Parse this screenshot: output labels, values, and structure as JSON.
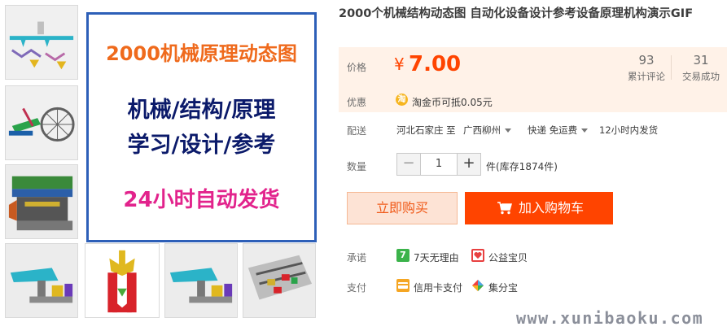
{
  "gallery": {
    "main_title": "2000机械原理动态图",
    "main_line1": "机械/结构/原理",
    "main_line2": "学习/设计/参考",
    "main_shipping": "24小时自动发货"
  },
  "product": {
    "title": "2000个机械结构动态图 自动化设备设计参考设备原理机构演示GIF"
  },
  "price": {
    "label": "价格",
    "currency": "¥",
    "amount": "7.00",
    "reviews_count": "93",
    "reviews_label": "累计评论",
    "sales_count": "31",
    "sales_label": "交易成功"
  },
  "promo": {
    "label": "优惠",
    "coin_glyph": "淘",
    "text": "淘金币可抵0.05元"
  },
  "shipping": {
    "label": "配送",
    "from": "河北石家庄 至",
    "to": "广西柳州",
    "method": "快递 免运费",
    "dispatch": "12小时内发货"
  },
  "quantity": {
    "label": "数量",
    "minus": "−",
    "value": "1",
    "plus": "+",
    "stock": "件(库存1874件)"
  },
  "actions": {
    "buy_now": "立即购买",
    "add_to_cart": "加入购物车"
  },
  "promise": {
    "label": "承诺",
    "return_icon": "7",
    "return_text": "7天无理由",
    "charity_text": "公益宝贝"
  },
  "payment": {
    "label": "支付",
    "card_text": "信用卡支付",
    "installment_text": "集分宝"
  },
  "watermark": "www.xunibaoku.com",
  "colors": {
    "accent": "#ff4400",
    "price_bg": "#fff2e8",
    "main_border": "#2d5fb8"
  }
}
